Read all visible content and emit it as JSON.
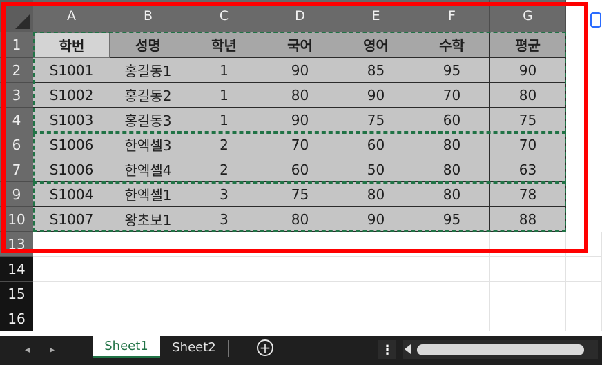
{
  "columns": [
    "A",
    "B",
    "C",
    "D",
    "E",
    "F",
    "G"
  ],
  "rows": [
    {
      "row_num": "1",
      "cells": [
        "학번",
        "성명",
        "학년",
        "국어",
        "영어",
        "수학",
        "평균"
      ]
    },
    {
      "row_num": "2",
      "cells": [
        "S1001",
        "홍길동1",
        "1",
        "90",
        "85",
        "95",
        "90"
      ]
    },
    {
      "row_num": "3",
      "cells": [
        "S1002",
        "홍길동2",
        "1",
        "80",
        "90",
        "70",
        "80"
      ]
    },
    {
      "row_num": "4",
      "cells": [
        "S1003",
        "홍길동3",
        "1",
        "90",
        "75",
        "60",
        "75"
      ]
    },
    {
      "row_num": "6",
      "cells": [
        "S1006",
        "한엑셀3",
        "2",
        "70",
        "60",
        "80",
        "70"
      ]
    },
    {
      "row_num": "7",
      "cells": [
        "S1006",
        "한엑셀4",
        "2",
        "60",
        "50",
        "80",
        "63"
      ]
    },
    {
      "row_num": "9",
      "cells": [
        "S1004",
        "한엑셀1",
        "3",
        "75",
        "80",
        "80",
        "78"
      ]
    },
    {
      "row_num": "10",
      "cells": [
        "S1007",
        "왕초보1",
        "3",
        "80",
        "90",
        "95",
        "88"
      ]
    }
  ],
  "empty_rows": [
    "13",
    "14",
    "15",
    "16"
  ],
  "sheets": {
    "tabs": [
      "Sheet1",
      "Sheet2"
    ],
    "add_label": "+",
    "more_label": "⋮"
  },
  "colors": {
    "accent": "#217346",
    "highlight": "#ff0000",
    "header_fill": "#a7a7a7",
    "data_fill": "#c5c5c5"
  }
}
